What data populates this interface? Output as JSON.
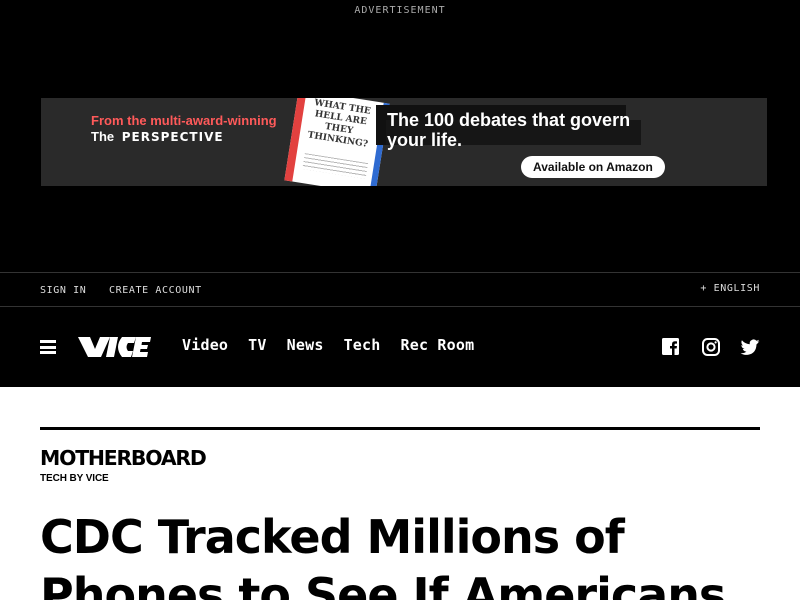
{
  "ad": {
    "label": "ADVERTISEMENT",
    "promo_line1": "From the multi-award-winning",
    "promo_line2_prefix": "The",
    "promo_line2_brand": "PERSPECTIVE",
    "book_title": "WHAT THE HELL ARE THEY THINKING?",
    "headline": "The 100 debates that govern your life.",
    "cta": "Available on Amazon",
    "colors": {
      "promo_red": "#ff5a5a",
      "book_red": "#e2413f",
      "book_blue": "#2f6bd1"
    }
  },
  "account_bar": {
    "sign_in": "SIGN IN",
    "create_account": "CREATE ACCOUNT",
    "language": "+ ENGLISH"
  },
  "nav": {
    "menu_icon": "hamburger-icon",
    "logo": "VICE",
    "items": [
      "Video",
      "TV",
      "News",
      "Tech",
      "Rec Room"
    ],
    "social": [
      "facebook-icon",
      "instagram-icon",
      "twitter-icon"
    ]
  },
  "article": {
    "section_logo": "MOTHERBOARD",
    "section_sub": "TECH BY VICE",
    "headline": "CDC Tracked Millions of Phones to See If Americans"
  }
}
